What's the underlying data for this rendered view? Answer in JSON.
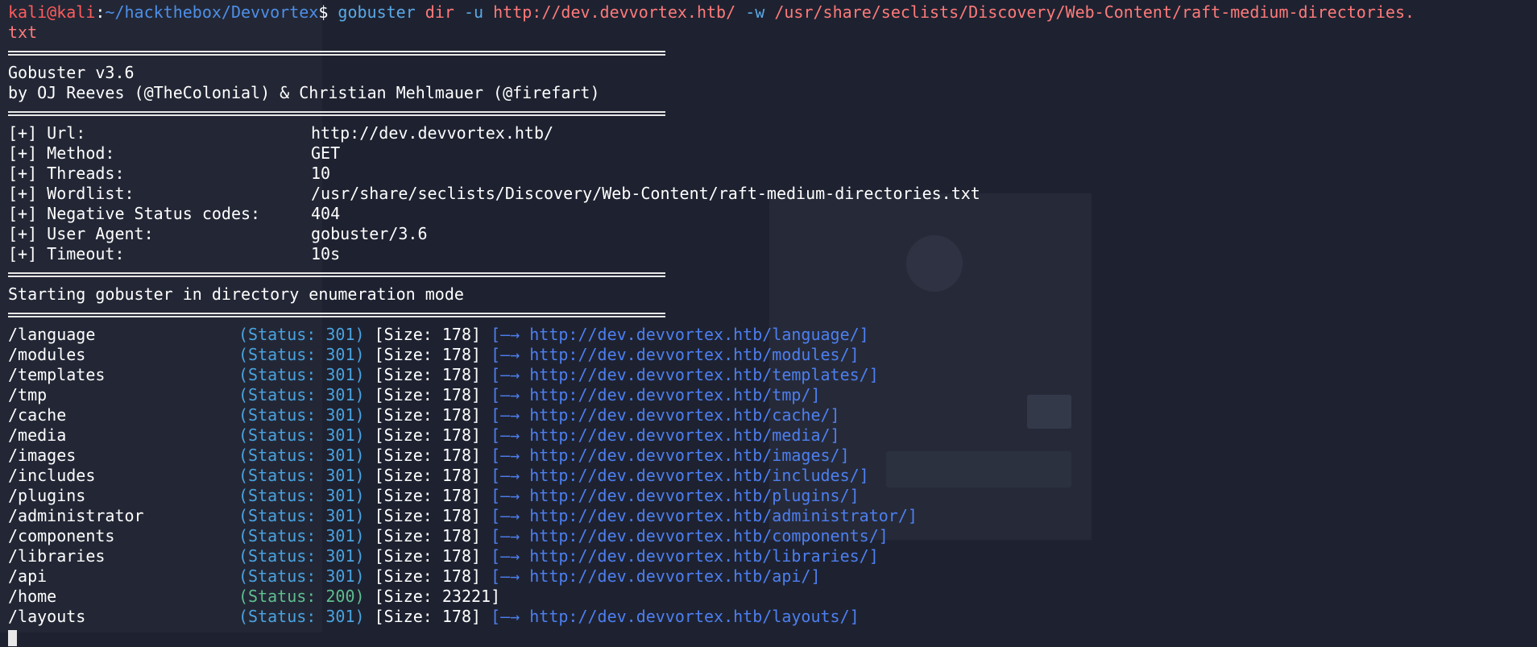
{
  "prompt": {
    "user": "kali@kali",
    "sep": ":",
    "path": "~/hackthebox/Devvortex",
    "symbol": "$"
  },
  "command": {
    "program": "gobuster",
    "subcommand": "dir",
    "flag_u": "-u",
    "url": "http://dev.devvortex.htb/",
    "flag_w": "-w",
    "wordlist_line1": "/usr/share/seclists/Discovery/Web-Content/raft-medium-directories.",
    "wordlist_line2": "txt"
  },
  "banner": {
    "version": "Gobuster v3.6",
    "authors": "by OJ Reeves (@TheColonial) & Christian Mehlmauer (@firefart)"
  },
  "config": [
    {
      "label": "[+] Url:",
      "value": "http://dev.devvortex.htb/"
    },
    {
      "label": "[+] Method:",
      "value": "GET"
    },
    {
      "label": "[+] Threads:",
      "value": "10"
    },
    {
      "label": "[+] Wordlist:",
      "value": "/usr/share/seclists/Discovery/Web-Content/raft-medium-directories.txt"
    },
    {
      "label": "[+] Negative Status codes:",
      "value": "404"
    },
    {
      "label": "[+] User Agent:",
      "value": "gobuster/3.6"
    },
    {
      "label": "[+] Timeout:",
      "value": "10s"
    }
  ],
  "mode_message": "Starting gobuster in directory enumeration mode",
  "results": [
    {
      "path": "/language",
      "status": "(Status: 301)",
      "size": "[Size: 178]",
      "redirect": "http://dev.devvortex.htb/language/"
    },
    {
      "path": "/modules",
      "status": "(Status: 301)",
      "size": "[Size: 178]",
      "redirect": "http://dev.devvortex.htb/modules/"
    },
    {
      "path": "/templates",
      "status": "(Status: 301)",
      "size": "[Size: 178]",
      "redirect": "http://dev.devvortex.htb/templates/"
    },
    {
      "path": "/tmp",
      "status": "(Status: 301)",
      "size": "[Size: 178]",
      "redirect": "http://dev.devvortex.htb/tmp/"
    },
    {
      "path": "/cache",
      "status": "(Status: 301)",
      "size": "[Size: 178]",
      "redirect": "http://dev.devvortex.htb/cache/"
    },
    {
      "path": "/media",
      "status": "(Status: 301)",
      "size": "[Size: 178]",
      "redirect": "http://dev.devvortex.htb/media/"
    },
    {
      "path": "/images",
      "status": "(Status: 301)",
      "size": "[Size: 178]",
      "redirect": "http://dev.devvortex.htb/images/"
    },
    {
      "path": "/includes",
      "status": "(Status: 301)",
      "size": "[Size: 178]",
      "redirect": "http://dev.devvortex.htb/includes/"
    },
    {
      "path": "/plugins",
      "status": "(Status: 301)",
      "size": "[Size: 178]",
      "redirect": "http://dev.devvortex.htb/plugins/"
    },
    {
      "path": "/administrator",
      "status": "(Status: 301)",
      "size": "[Size: 178]",
      "redirect": "http://dev.devvortex.htb/administrator/"
    },
    {
      "path": "/components",
      "status": "(Status: 301)",
      "size": "[Size: 178]",
      "redirect": "http://dev.devvortex.htb/components/"
    },
    {
      "path": "/libraries",
      "status": "(Status: 301)",
      "size": "[Size: 178]",
      "redirect": "http://dev.devvortex.htb/libraries/"
    },
    {
      "path": "/api",
      "status": "(Status: 301)",
      "size": "[Size: 178]",
      "redirect": "http://dev.devvortex.htb/api/"
    },
    {
      "path": "/home",
      "status": "(Status: 200)",
      "size": "[Size: 23221]",
      "redirect": ""
    },
    {
      "path": "/layouts",
      "status": "(Status: 301)",
      "size": "[Size: 178]",
      "redirect": "http://dev.devvortex.htb/layouts/"
    }
  ],
  "arrow_symbol": "[—→",
  "arrow_close": "]",
  "colors": {
    "background": "#1e2230",
    "prompt_user": "#ff5c5c",
    "prompt_path": "#4d8fe8",
    "status": "#4aa3e0",
    "status_ok": "#5fbf8e",
    "link": "#4d7ff0"
  }
}
